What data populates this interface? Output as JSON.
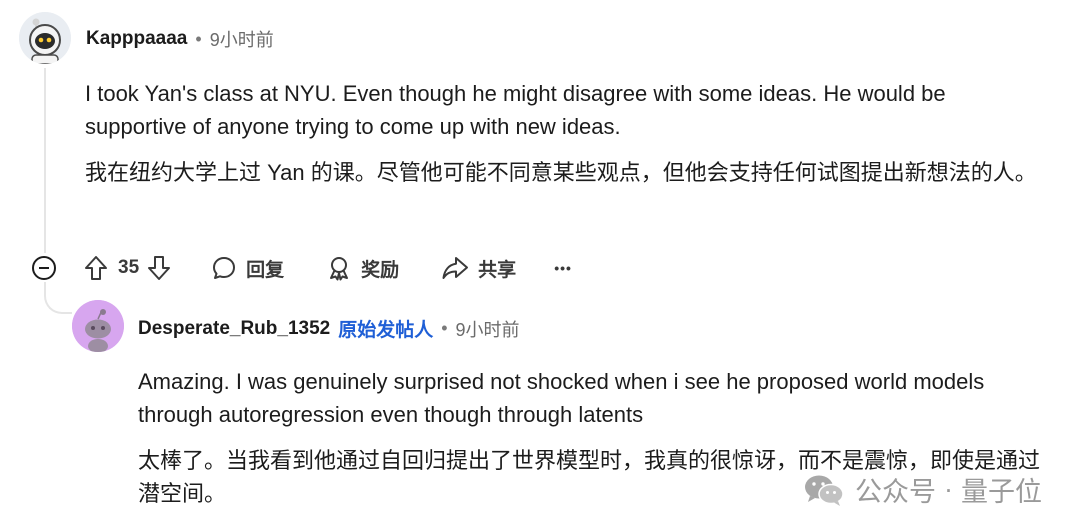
{
  "comment1": {
    "username": "Kapppaaaa",
    "separator": "•",
    "time": "9小时前",
    "text_en": "I took Yan's class at NYU. Even though he might disagree with some ideas. He would be supportive of anyone trying to come up with new ideas.",
    "text_zh": "我在纽约大学上过 Yan 的课。尽管他可能不同意某些观点，但他会支持任何试图提出新想法的人。",
    "actions": {
      "vote_count": "35",
      "reply_label": "回复",
      "award_label": "奖励",
      "share_label": "共享",
      "more_label": "•••"
    }
  },
  "comment2": {
    "username": "Desperate_Rub_1352",
    "op_badge": "原始发帖人",
    "separator": "•",
    "time": "9小时前",
    "text_en": "Amazing. I was genuinely surprised not shocked when i see he proposed world models through autoregression even though through latents",
    "text_zh": "太棒了。当我看到他通过自回归提出了世界模型时，我真的很惊讶，而不是震惊，即使是通过潜空间。"
  },
  "watermark": {
    "text": "公众号",
    "separator": "·",
    "brand": "量子位"
  },
  "colors": {
    "op_badge": "#1f5fd6",
    "avatar2_bg": "#d7a6ef",
    "thread_line": "#e5e5e5"
  }
}
